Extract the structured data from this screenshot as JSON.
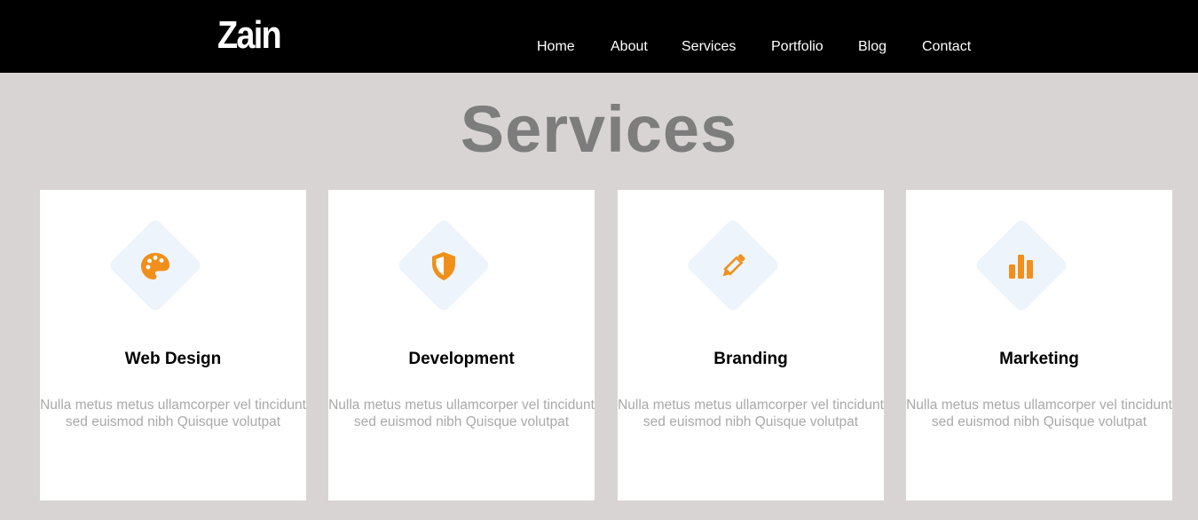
{
  "brand": {
    "logo": "Zain"
  },
  "nav": {
    "items": [
      {
        "label": "Home"
      },
      {
        "label": "About"
      },
      {
        "label": "Services"
      },
      {
        "label": "Portfolio"
      },
      {
        "label": "Blog"
      },
      {
        "label": "Contact"
      }
    ]
  },
  "services": {
    "title": "Services",
    "cards": [
      {
        "title": "Web Design",
        "text": "Nulla metus metus ullamcorper vel tincidunt sed euismod nibh Quisque volutpat",
        "icon": "palette-icon"
      },
      {
        "title": "Development",
        "text": "Nulla metus metus ullamcorper vel tincidunt sed euismod nibh Quisque volutpat",
        "icon": "shield-icon"
      },
      {
        "title": "Branding",
        "text": "Nulla metus metus ullamcorper vel tincidunt sed euismod nibh Quisque volutpat",
        "icon": "pencil-icon"
      },
      {
        "title": "Marketing",
        "text": "Nulla metus metus ullamcorper vel tincidunt sed euismod nibh Quisque volutpat",
        "icon": "bar-chart-icon"
      }
    ]
  },
  "colors": {
    "navbar_bg": "#000000",
    "page_bg": "#d9d4d4",
    "accent": "#f0901a",
    "icon_bg": "#eef4fb",
    "title_gray": "#7d7d7d",
    "body_text": "#a9a9a9"
  }
}
